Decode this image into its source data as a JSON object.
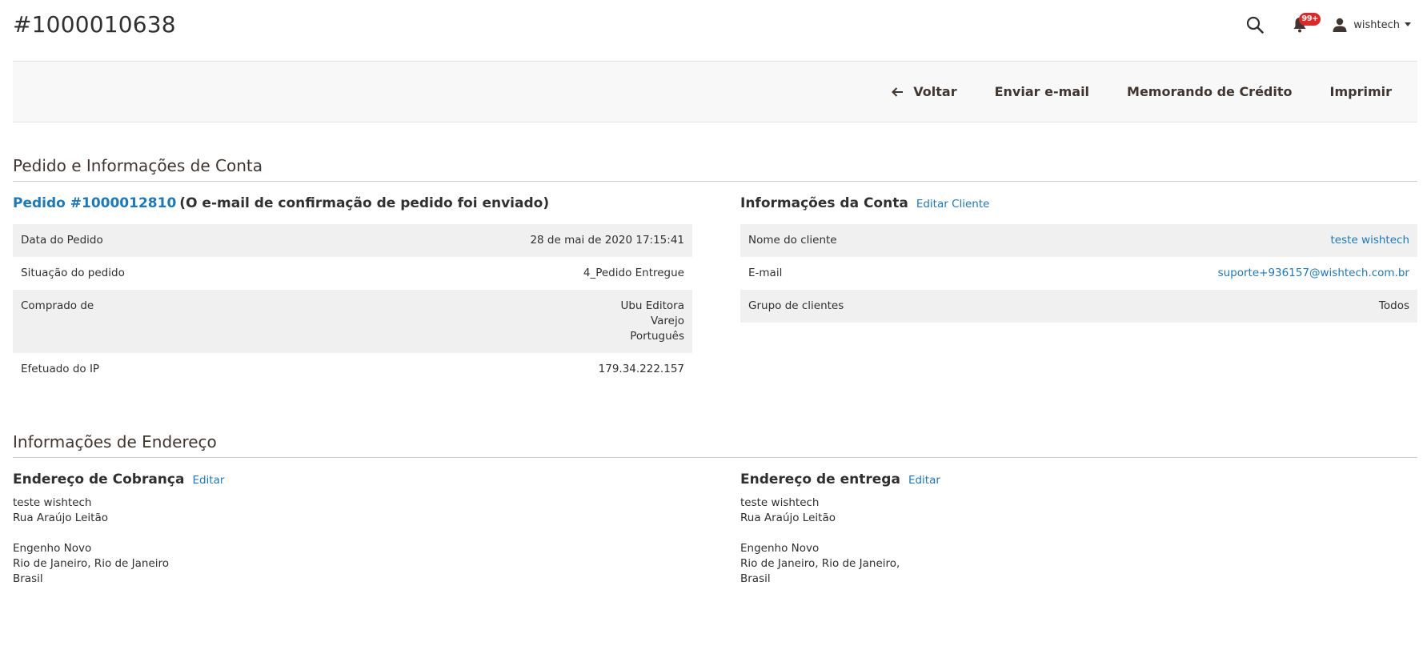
{
  "header": {
    "title": "#1000010638",
    "notification_badge": "99+",
    "user_name": "wishtech"
  },
  "toolbar": {
    "back_label": "Voltar",
    "send_email_label": "Enviar e-mail",
    "credit_memo_label": "Memorando de Crédito",
    "print_label": "Imprimir"
  },
  "order_account_section": {
    "title": "Pedido e Informações de Conta",
    "order": {
      "link_text": "Pedido #1000012810",
      "note": "(O e-mail de confirmação de pedido foi enviado)",
      "rows": [
        {
          "label": "Data do Pedido",
          "value": "28 de mai de 2020 17:15:41"
        },
        {
          "label": "Situação do pedido",
          "value": "4_Pedido Entregue"
        },
        {
          "label": "Comprado de",
          "lines": [
            "Ubu Editora",
            "Varejo",
            "Português"
          ]
        },
        {
          "label": "Efetuado do IP",
          "value": "179.34.222.157"
        }
      ]
    },
    "account": {
      "title": "Informações da Conta",
      "edit_label": "Editar Cliente",
      "rows": [
        {
          "label": "Nome do cliente",
          "value": "teste wishtech"
        },
        {
          "label": "E-mail",
          "value": "suporte+936157@wishtech.com.br"
        },
        {
          "label": "Grupo de clientes",
          "value": "Todos"
        }
      ]
    }
  },
  "address_section": {
    "title": "Informações de Endereço",
    "billing": {
      "title": "Endereço de Cobrança",
      "edit_label": "Editar",
      "lines": [
        "teste wishtech",
        "Rua Araújo Leitão",
        "",
        "Engenho Novo",
        "Rio de Janeiro, Rio de Janeiro",
        "Brasil"
      ]
    },
    "shipping": {
      "title": "Endereço de entrega",
      "edit_label": "Editar",
      "lines": [
        "teste wishtech",
        "Rua Araújo Leitão",
        "",
        "Engenho Novo",
        "Rio de Janeiro, Rio de Janeiro,",
        "Brasil"
      ]
    }
  },
  "colors": {
    "link": "#1979c3",
    "badge": "#e22626",
    "toolbar_bg": "#f8f8f8",
    "row_alt_bg": "#f0f0f0"
  },
  "icons": [
    "search-icon",
    "bell-icon",
    "user-icon",
    "caret-down-icon",
    "arrow-left-icon"
  ]
}
